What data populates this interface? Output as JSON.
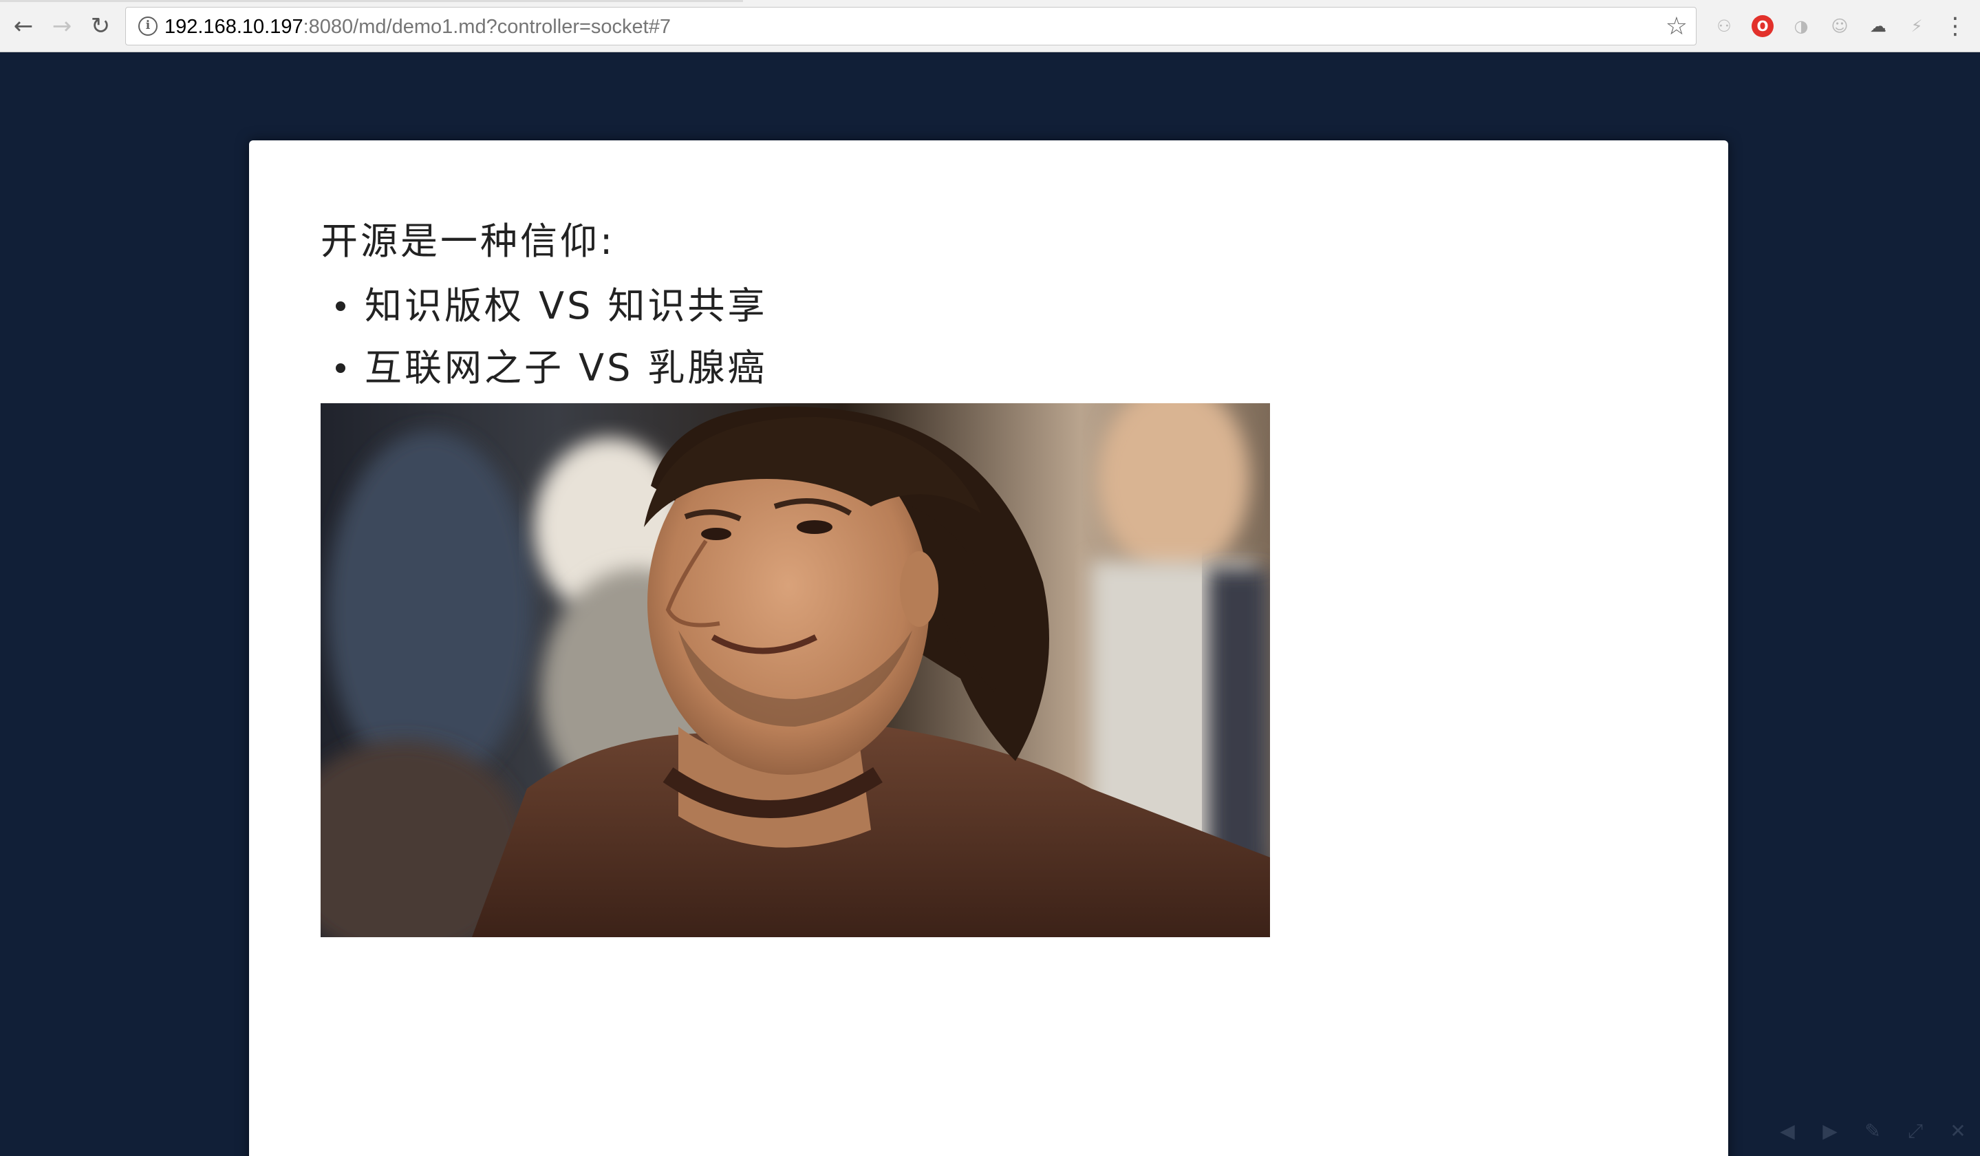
{
  "browser": {
    "url_host": "192.168.10.197",
    "url_path": ":8080/md/demo1.md?controller=socket#7",
    "icons": [
      "back-icon",
      "forward-icon",
      "reload-icon",
      "info-icon",
      "bookmark-star-icon"
    ],
    "extensions": [
      "extension-sitemap-icon",
      "opera-icon",
      "extension-icon",
      "extension-face-icon",
      "cloud-icon",
      "flash-player-icon",
      "menu-icon"
    ]
  },
  "slide": {
    "heading": "开源是一种信仰:",
    "bullets": [
      "知识版权 VS 知识共享",
      "互联网之子 VS 乳腺癌"
    ]
  },
  "controls": [
    "prev-slide-icon",
    "next-slide-icon",
    "pen-icon",
    "fullscreen-icon",
    "close-icon"
  ]
}
